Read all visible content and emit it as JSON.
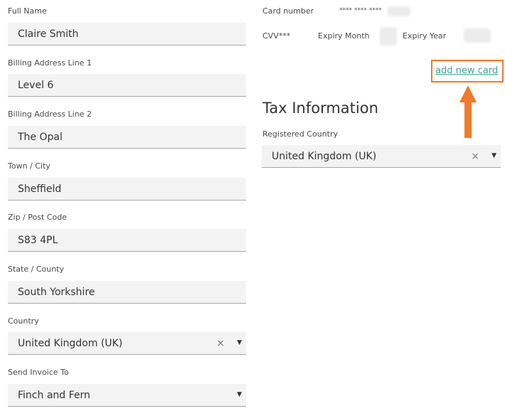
{
  "billing": {
    "full_name": {
      "label": "Full Name",
      "value": "Claire Smith"
    },
    "address_line1": {
      "label": "Billing Address Line 1",
      "value": "Level 6"
    },
    "address_line2": {
      "label": "Billing Address Line 2",
      "value": "The Opal"
    },
    "town": {
      "label": "Town / City",
      "value": "Sheffield"
    },
    "zip": {
      "label": "Zip / Post Code",
      "value": "S83 4PL"
    },
    "state": {
      "label": "State / County",
      "value": "South Yorkshire"
    },
    "country": {
      "label": "Country",
      "value": "United Kingdom (UK)"
    },
    "invoice_to": {
      "label": "Send Invoice To",
      "value": "Finch and Fern"
    }
  },
  "card": {
    "number_label": "Card number",
    "number_mask": "**** **** ****",
    "cvv_label": "CVV***",
    "expiry_month_label": "Expiry Month",
    "expiry_year_label": "Expiry Year",
    "add_new_card_link": "add new card"
  },
  "tax": {
    "title": "Tax Information",
    "registered_country_label": "Registered Country",
    "registered_country_value": "United Kingdom (UK)"
  },
  "icons": {
    "clear": "×",
    "caret": "▼"
  },
  "colors": {
    "accent_link": "#3ca59a",
    "annotation": "#f07a2b",
    "input_bg": "#f3f3f3"
  }
}
